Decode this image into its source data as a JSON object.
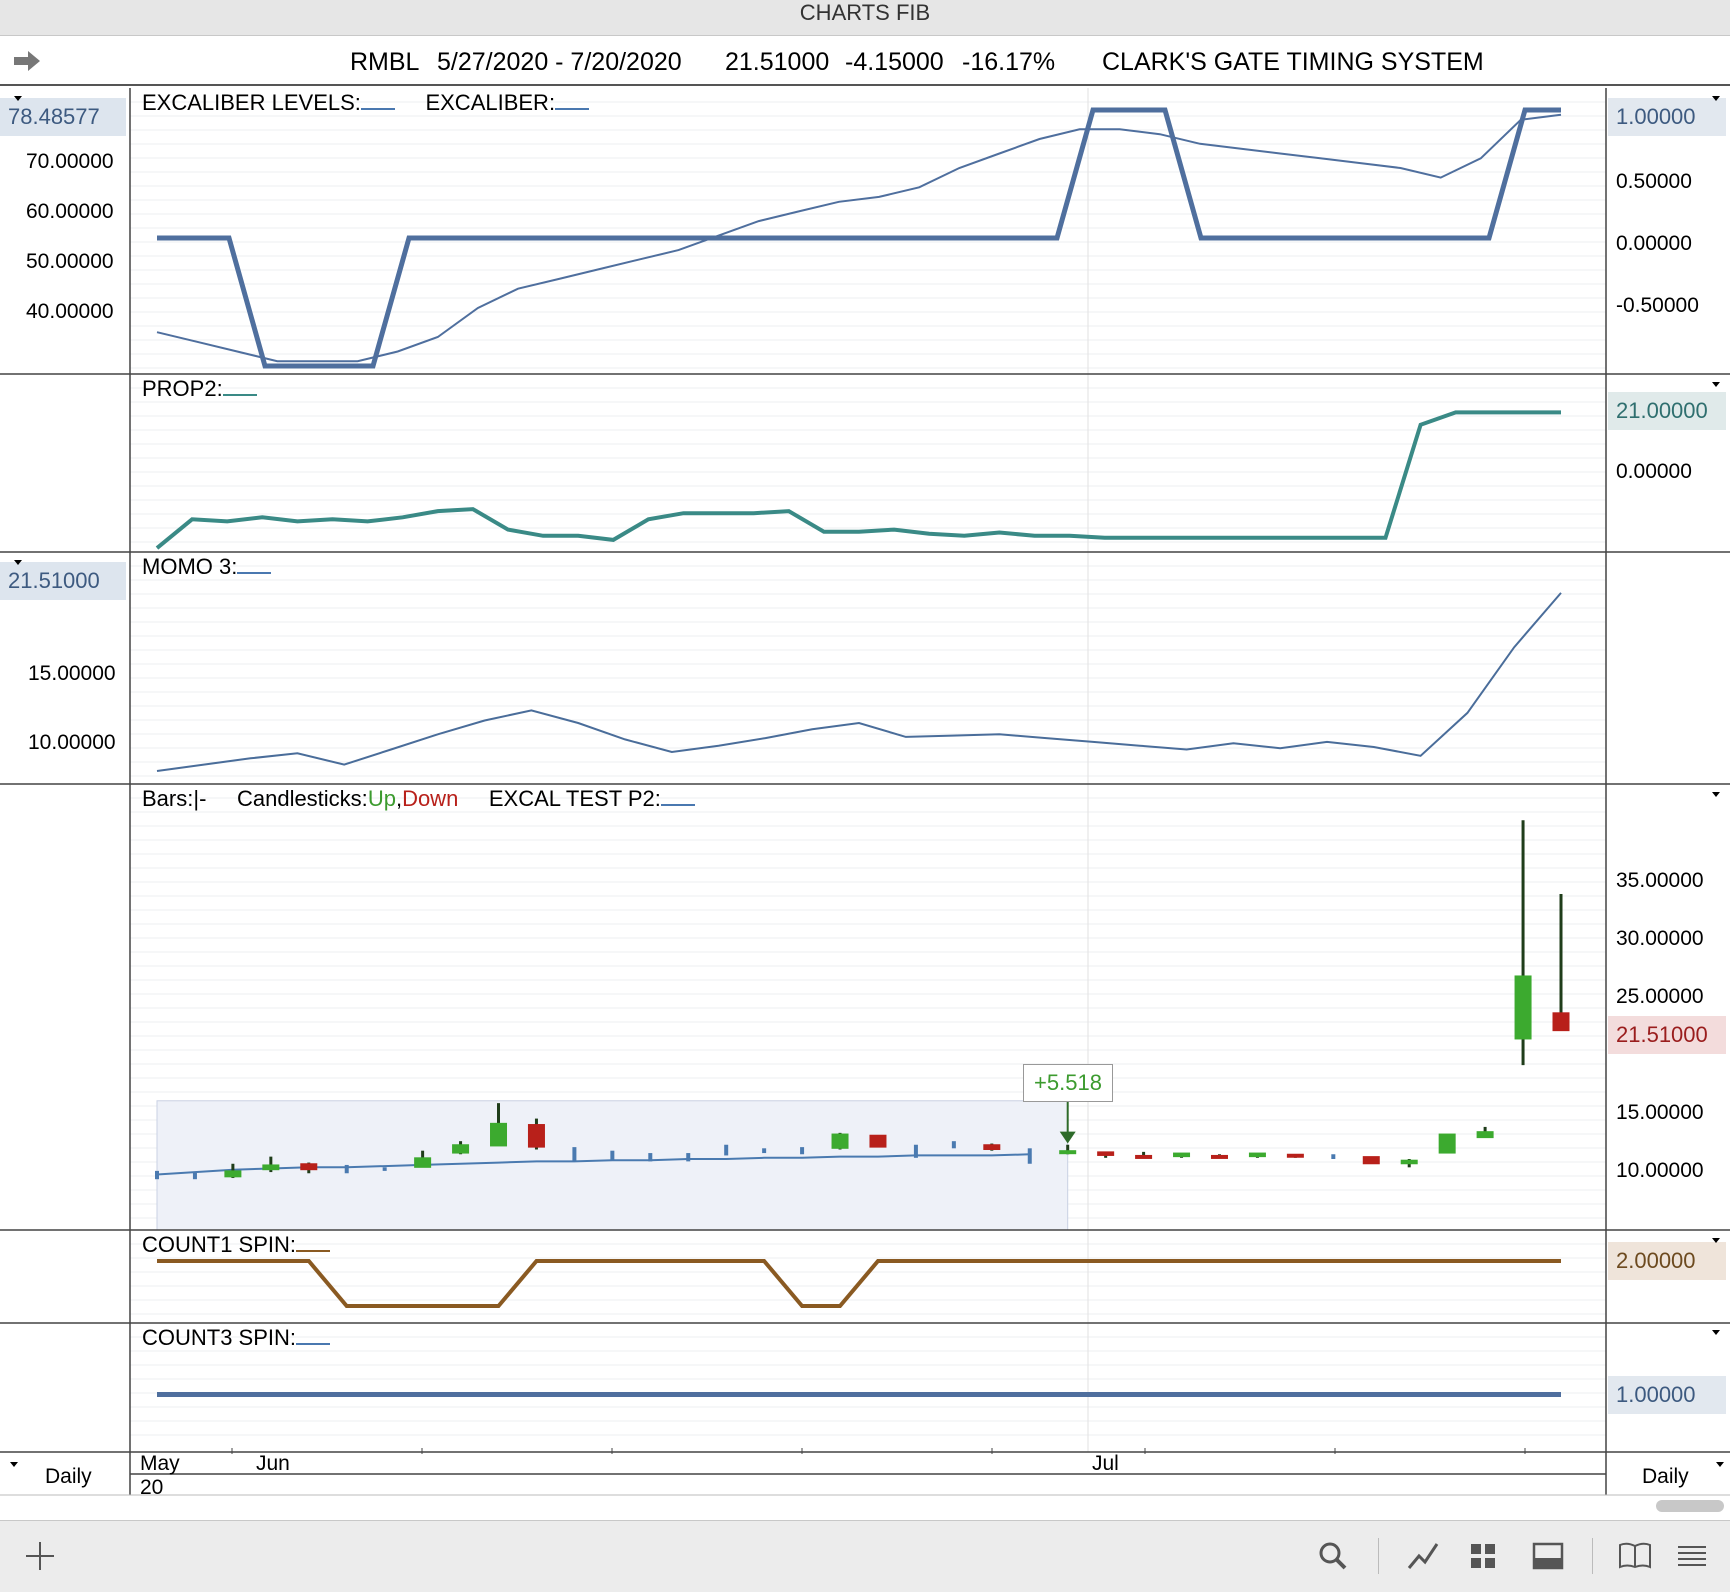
{
  "window": {
    "title": "CHARTS FIB"
  },
  "header": {
    "symbol": "RMBL",
    "date_range": "5/27/2020 - 7/20/2020",
    "last": "21.51000",
    "change": "-4.15000",
    "change_pct": "-16.17%",
    "system": "CLARK'S GATE TIMING SYSTEM"
  },
  "panels": {
    "excaliber": {
      "label1": "EXCALIBER LEVELS:",
      "label2": "EXCALIBER:",
      "left_tag": "78.48577",
      "left_ticks": [
        "70.00000",
        "60.00000",
        "50.00000",
        "40.00000"
      ],
      "right_tag": "1.00000",
      "right_ticks": [
        "0.50000",
        "0.00000",
        "-0.50000"
      ]
    },
    "prop2": {
      "label": "PROP2:",
      "right_tag": "21.00000",
      "right_ticks": [
        "0.00000"
      ]
    },
    "momo3": {
      "label": "MOMO 3:",
      "left_tag": "21.51000",
      "left_ticks": [
        "15.00000",
        "10.00000"
      ]
    },
    "price": {
      "label_bars": "Bars:",
      "label_bars_symbol": "|-",
      "label_candles": "Candlesticks:",
      "label_up": "Up",
      "label_comma": ",",
      "label_down": "Down",
      "label_test": "EXCAL  TEST P2:",
      "right_ticks": [
        "35.00000",
        "30.00000",
        "25.00000",
        "15.00000",
        "10.00000"
      ],
      "right_tag": "21.51000",
      "annotation": "+5.518"
    },
    "count1": {
      "label": "COUNT1 SPIN:",
      "right_tag": "2.00000"
    },
    "count3": {
      "label": "COUNT3 SPIN:",
      "right_tag": "1.00000"
    }
  },
  "xaxis": {
    "left_label": "Daily",
    "right_label": "Daily",
    "months": [
      "May",
      "Jun",
      "Jul"
    ],
    "year": "20"
  },
  "toolbar": {
    "icons": [
      "plus-icon",
      "search-icon",
      "draw-line-icon",
      "grid-icon",
      "panel-icon",
      "book-icon",
      "menu-icon"
    ]
  },
  "colors": {
    "excaliber": "#4f6f9e",
    "prop2": "#3a8a86",
    "momo": "#4a6d9a",
    "count1": "#8a5a22",
    "count3": "#4f6f9e",
    "up": "#3caa2f",
    "down": "#b8201a",
    "bar": "#4a7ab0"
  },
  "chart_data": [
    {
      "type": "line",
      "name_panel": "EXCALIBER",
      "x": [
        1,
        2,
        3,
        4,
        5,
        6,
        7,
        8,
        9,
        10,
        11,
        12,
        13,
        14,
        15,
        16,
        17,
        18,
        19,
        20,
        21,
        22,
        23,
        24,
        25,
        26,
        27,
        28,
        29,
        30,
        31,
        32,
        33,
        34,
        35,
        36,
        37,
        38
      ],
      "series": [
        {
          "name": "EXCALIBER LEVELS",
          "axis": "right",
          "values": [
            0,
            0,
            0,
            -1,
            -1,
            -1,
            -1,
            0,
            0,
            0,
            0,
            0,
            0,
            0,
            0,
            0,
            0,
            0,
            0,
            0,
            0,
            0,
            0,
            0,
            0,
            0,
            1,
            1,
            1,
            0,
            0,
            0,
            0,
            0,
            0,
            0,
            0,
            0,
            1,
            1
          ]
        },
        {
          "name": "EXCALIBER",
          "axis": "left",
          "values": [
            34,
            32,
            30,
            28,
            28,
            28,
            30,
            33,
            39,
            43,
            45,
            47,
            49,
            51,
            54,
            57,
            59,
            61,
            62,
            64,
            68,
            71,
            74,
            76,
            76,
            75,
            73,
            72,
            71,
            70,
            69,
            68,
            66,
            70,
            78,
            79
          ]
        }
      ],
      "ylim_left": [
        27,
        80
      ],
      "ylim_right": [
        -1,
        1
      ]
    },
    {
      "type": "line",
      "name_panel": "PROP2",
      "x": [
        1,
        2,
        3,
        4,
        5,
        6,
        7,
        8,
        9,
        10,
        11,
        12,
        13,
        14,
        15,
        16,
        17,
        18,
        19,
        20,
        21,
        22,
        23,
        24,
        25,
        26,
        27,
        28,
        29,
        30,
        31,
        32,
        33,
        34,
        35,
        36,
        37,
        38
      ],
      "values": [
        -12,
        -5,
        -5.5,
        -4.5,
        -5.5,
        -5,
        -5.5,
        -4.5,
        -3,
        -2.5,
        -7.5,
        -9,
        -9,
        -10,
        -5,
        -3.5,
        -3.5,
        -3.5,
        -3,
        -8,
        -8,
        -7.5,
        -8.5,
        -9,
        -8.2,
        -9,
        -9,
        -9.5,
        -9.5,
        -9.5,
        -9.5,
        -9.5,
        -9.5,
        -9.5,
        -9.5,
        -9.5,
        18,
        21,
        21,
        21,
        21
      ],
      "ylim": [
        -11,
        25
      ]
    },
    {
      "type": "line",
      "name_panel": "MOMO 3",
      "values": [
        7.4,
        7.9,
        8.4,
        8.8,
        7.9,
        9.1,
        10.3,
        11.4,
        12.2,
        11.2,
        9.9,
        8.9,
        9.4,
        10.0,
        10.7,
        11.2,
        10.1,
        10.2,
        10.3,
        10.0,
        9.7,
        9.4,
        9.1,
        9.6,
        9.2,
        9.7,
        9.3,
        8.6,
        12.0,
        17.2,
        21.5
      ],
      "ylim": [
        7,
        23
      ]
    },
    {
      "type": "candlestick",
      "name_panel": "Price",
      "candles": [
        {
          "o": 9.0,
          "h": 9.3,
          "l": 8.6,
          "c": 8.9,
          "t": "bar"
        },
        {
          "o": 8.9,
          "h": 9.2,
          "l": 8.6,
          "c": 9.0,
          "t": "bar"
        },
        {
          "o": 8.8,
          "h": 9.9,
          "l": 8.7,
          "c": 9.3,
          "t": "up"
        },
        {
          "o": 9.4,
          "h": 10.5,
          "l": 9.2,
          "c": 9.8,
          "t": "up"
        },
        {
          "o": 9.9,
          "h": 10.0,
          "l": 9.1,
          "c": 9.4,
          "t": "down"
        },
        {
          "o": 9.5,
          "h": 9.8,
          "l": 9.1,
          "c": 9.4,
          "t": "bar"
        },
        {
          "o": 9.4,
          "h": 9.6,
          "l": 9.3,
          "c": 9.5,
          "t": "bar"
        },
        {
          "o": 9.6,
          "h": 11.0,
          "l": 9.6,
          "c": 10.4,
          "t": "up"
        },
        {
          "o": 10.8,
          "h": 11.8,
          "l": 10.7,
          "c": 11.5,
          "t": "up"
        },
        {
          "o": 11.4,
          "h": 15.0,
          "l": 11.4,
          "c": 13.3,
          "t": "up"
        },
        {
          "o": 13.2,
          "h": 13.7,
          "l": 11.1,
          "c": 11.3,
          "t": "down"
        },
        {
          "o": 10.4,
          "h": 11.3,
          "l": 10.1,
          "c": 10.4,
          "t": "bar"
        },
        {
          "o": 10.5,
          "h": 11.0,
          "l": 10.2,
          "c": 10.4,
          "t": "bar"
        },
        {
          "o": 10.6,
          "h": 10.8,
          "l": 10.1,
          "c": 10.5,
          "t": "bar"
        },
        {
          "o": 10.4,
          "h": 10.8,
          "l": 10.1,
          "c": 10.6,
          "t": "bar"
        },
        {
          "o": 10.8,
          "h": 11.5,
          "l": 10.6,
          "c": 11.0,
          "t": "bar"
        },
        {
          "o": 10.9,
          "h": 11.2,
          "l": 10.8,
          "c": 11.0,
          "t": "bar"
        },
        {
          "o": 10.8,
          "h": 11.3,
          "l": 10.7,
          "c": 11.2,
          "t": "bar"
        },
        {
          "o": 11.2,
          "h": 12.5,
          "l": 11.1,
          "c": 12.4,
          "t": "up"
        },
        {
          "o": 12.3,
          "h": 12.3,
          "l": 11.3,
          "c": 11.3,
          "t": "down"
        },
        {
          "o": 11.4,
          "h": 11.5,
          "l": 10.4,
          "c": 11.0,
          "t": "bar"
        },
        {
          "o": 11.5,
          "h": 11.8,
          "l": 11.2,
          "c": 11.5,
          "t": "bar"
        },
        {
          "o": 11.5,
          "h": 11.6,
          "l": 11.0,
          "c": 11.1,
          "t": "down"
        },
        {
          "o": 10.9,
          "h": 11.2,
          "l": 9.9,
          "c": 10.9,
          "t": "bar"
        },
        {
          "o": 10.8,
          "h": 11.5,
          "l": 10.7,
          "c": 11.0,
          "t": "up"
        },
        {
          "o": 10.9,
          "h": 10.9,
          "l": 10.4,
          "c": 10.6,
          "t": "down"
        },
        {
          "o": 10.6,
          "h": 10.9,
          "l": 10.4,
          "c": 10.5,
          "t": "down"
        },
        {
          "o": 10.5,
          "h": 10.8,
          "l": 10.4,
          "c": 10.8,
          "t": "up"
        },
        {
          "o": 10.6,
          "h": 10.7,
          "l": 10.4,
          "c": 10.4,
          "t": "down"
        },
        {
          "o": 10.5,
          "h": 10.8,
          "l": 10.4,
          "c": 10.8,
          "t": "up"
        },
        {
          "o": 10.7,
          "h": 10.7,
          "l": 10.4,
          "c": 10.5,
          "t": "down"
        },
        {
          "o": 10.5,
          "h": 10.7,
          "l": 10.3,
          "c": 10.5,
          "t": "bar"
        },
        {
          "o": 10.5,
          "h": 10.5,
          "l": 9.9,
          "c": 9.9,
          "t": "down"
        },
        {
          "o": 9.9,
          "h": 10.3,
          "l": 9.6,
          "c": 10.2,
          "t": "up"
        },
        {
          "o": 10.8,
          "h": 12.4,
          "l": 10.8,
          "c": 12.4,
          "t": "up"
        },
        {
          "o": 12.1,
          "h": 13.0,
          "l": 12.1,
          "c": 12.6,
          "t": "up"
        },
        {
          "o": 20.4,
          "h": 38.8,
          "l": 18.2,
          "c": 25.7,
          "t": "up"
        },
        {
          "o": 22.6,
          "h": 32.6,
          "l": 21.1,
          "c": 21.1,
          "t": "down"
        }
      ],
      "excal_test_line": [
        9.0,
        9.2,
        9.4,
        9.5,
        9.6,
        9.6,
        9.7,
        9.8,
        9.9,
        10.0,
        10.1,
        10.1,
        10.2,
        10.2,
        10.3,
        10.3,
        10.4,
        10.4,
        10.5,
        10.5,
        10.6,
        10.6,
        10.6,
        10.7
      ],
      "annotation": {
        "text": "+5.518"
      },
      "ylim": [
        5,
        40
      ]
    },
    {
      "type": "line",
      "name_panel": "COUNT1 SPIN",
      "values": [
        2,
        2,
        2,
        2,
        2,
        1,
        1,
        1,
        1,
        1,
        2,
        2,
        2,
        2,
        2,
        2,
        2,
        1,
        1,
        2,
        2,
        2,
        2,
        2,
        2,
        2,
        2,
        2,
        2,
        2,
        2,
        2,
        2,
        2,
        2,
        2,
        2,
        2
      ],
      "ylim": [
        0.8,
        2.2
      ]
    },
    {
      "type": "line",
      "name_panel": "COUNT3 SPIN",
      "values": [
        1,
        1
      ],
      "ylim": [
        0,
        2
      ]
    }
  ]
}
